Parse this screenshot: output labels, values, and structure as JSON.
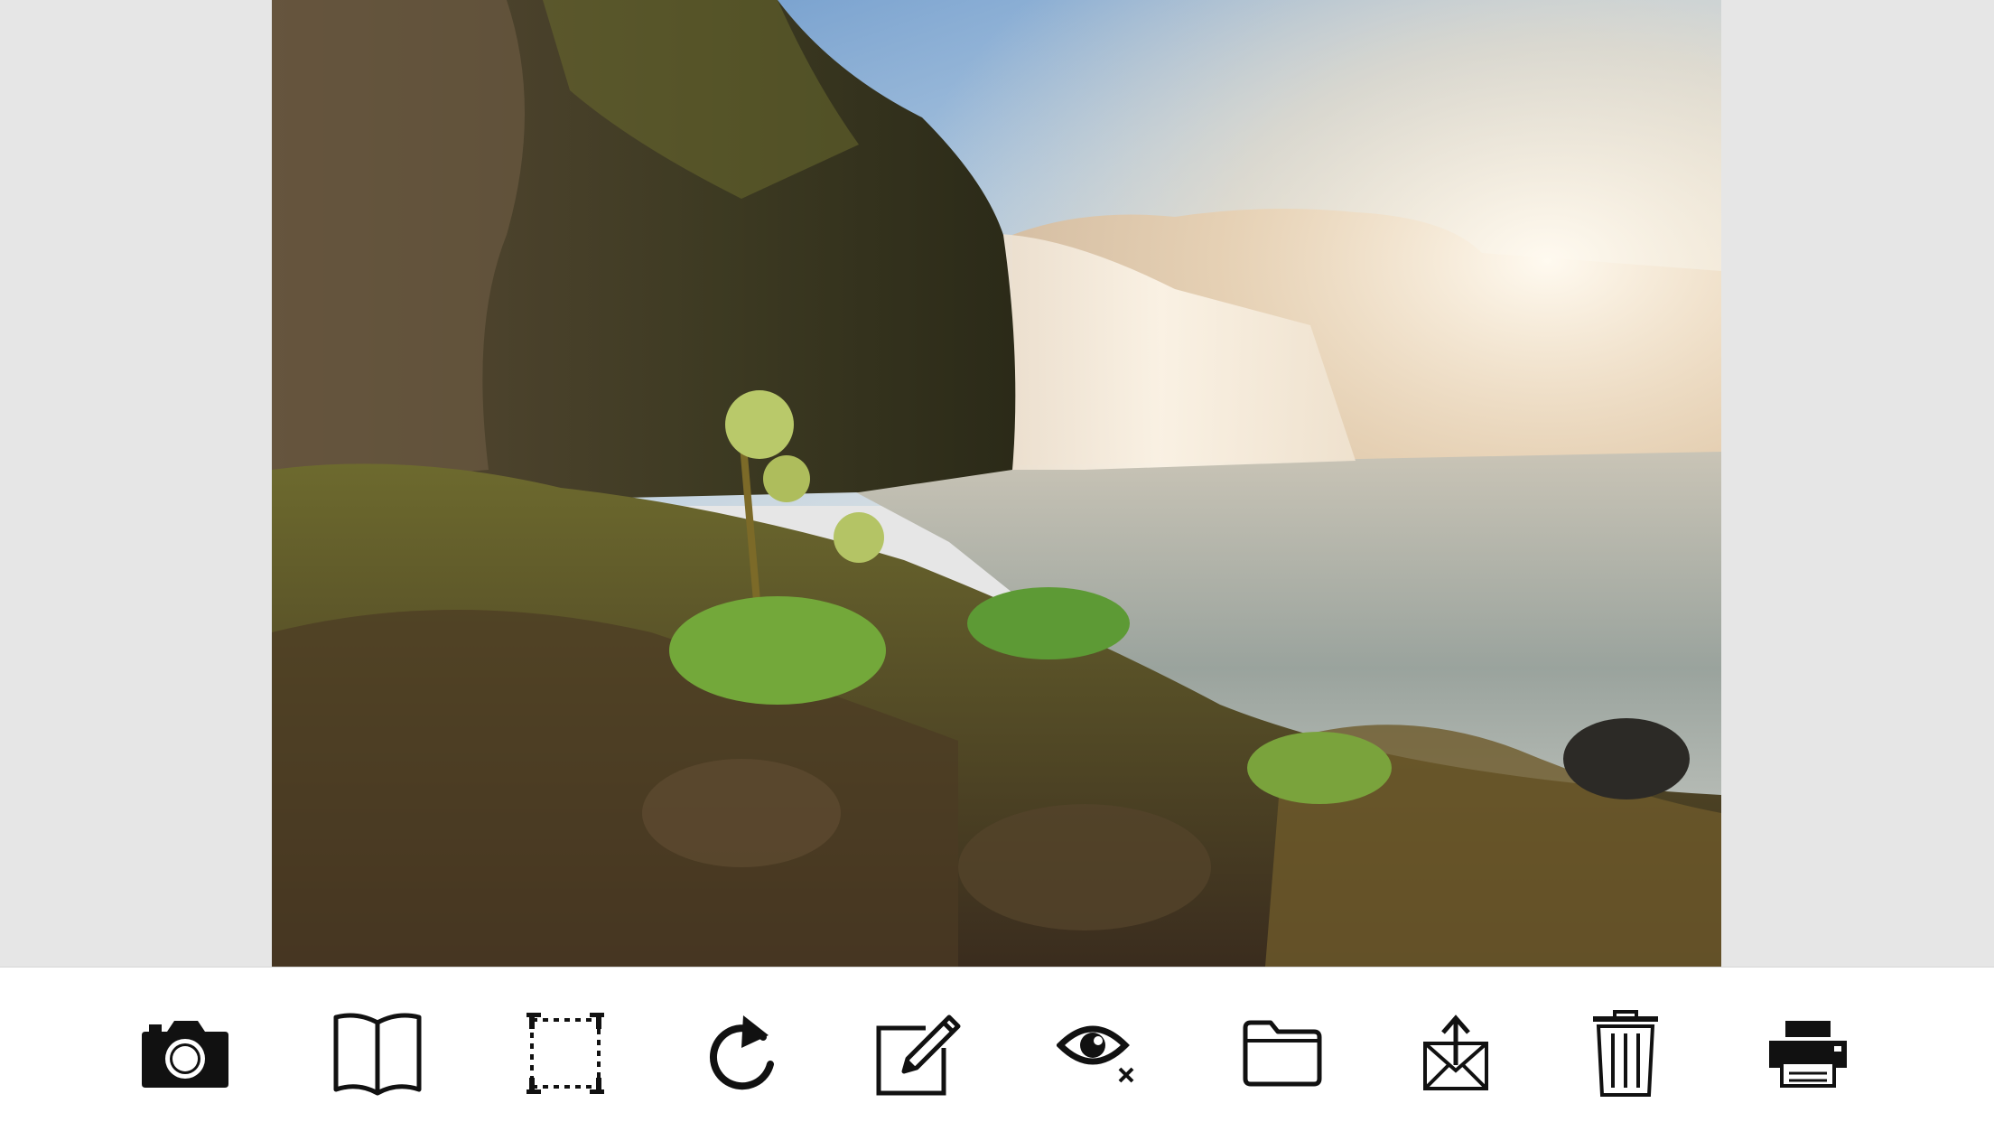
{
  "viewer": {
    "background": "#e6e6e6",
    "photo": {
      "subject": "waterfall-landscape"
    }
  },
  "toolbar": {
    "background": "#ffffff",
    "icon_color": "#111111",
    "tools": [
      {
        "id": "camera",
        "icon": "camera-icon"
      },
      {
        "id": "book",
        "icon": "open-book-icon"
      },
      {
        "id": "crop",
        "icon": "crop-selection-icon"
      },
      {
        "id": "rotate",
        "icon": "rotate-clockwise-icon"
      },
      {
        "id": "edit",
        "icon": "edit-pencil-icon"
      },
      {
        "id": "hide",
        "icon": "eye-remove-icon"
      },
      {
        "id": "folder",
        "icon": "folder-icon"
      },
      {
        "id": "export",
        "icon": "export-mail-icon"
      },
      {
        "id": "delete",
        "icon": "trash-icon"
      },
      {
        "id": "print",
        "icon": "printer-icon"
      }
    ]
  }
}
